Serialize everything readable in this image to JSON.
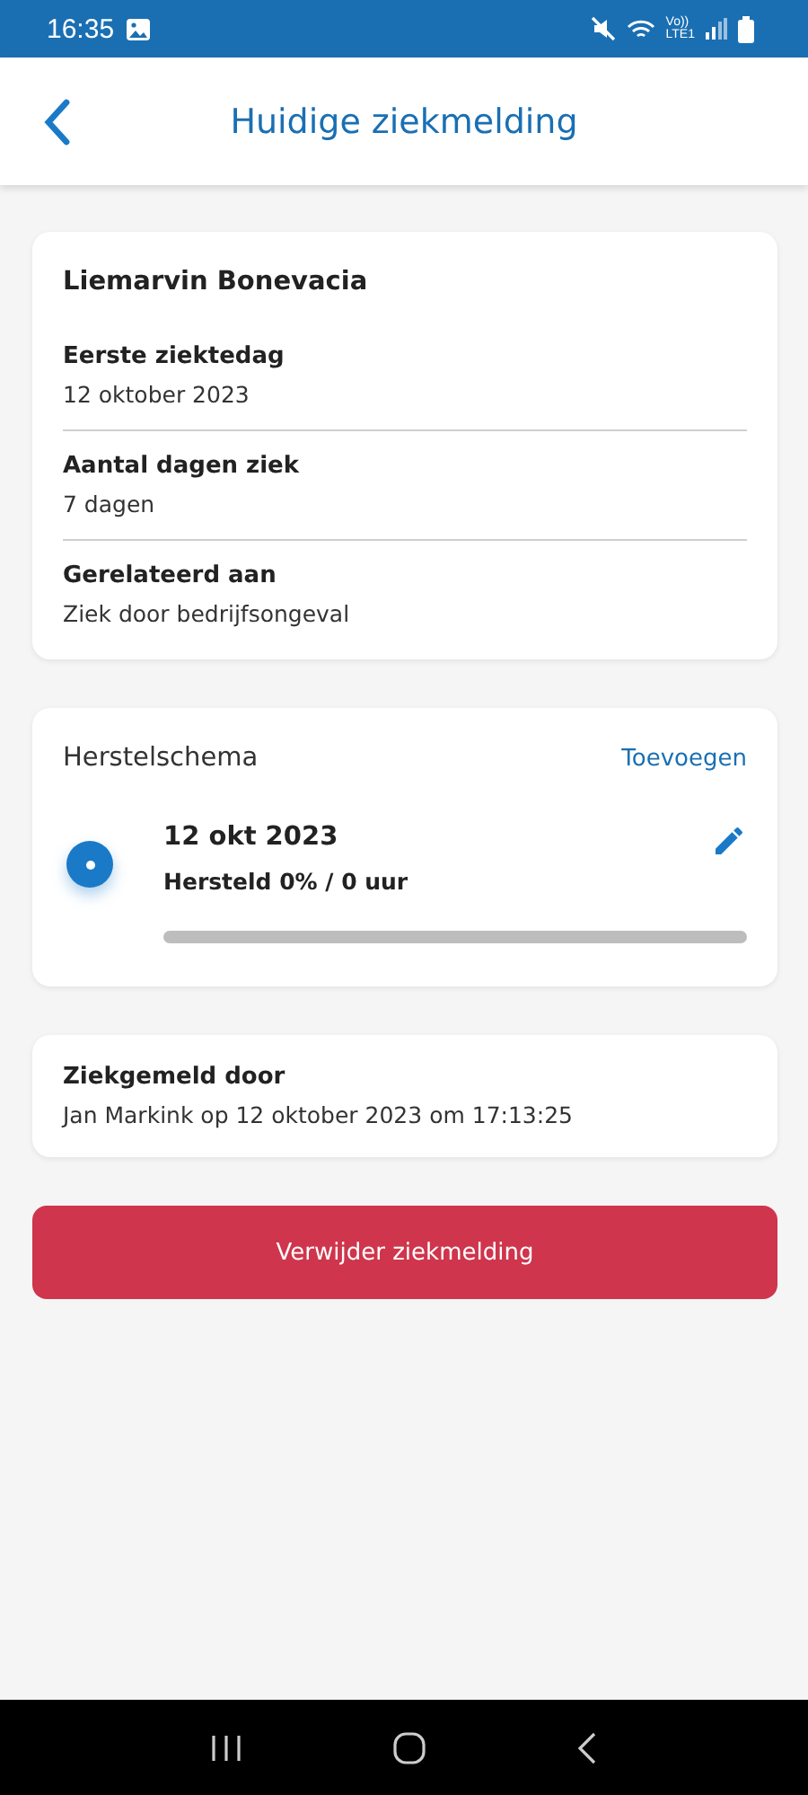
{
  "status_bar": {
    "time": "16:35",
    "network_top": "Vo))",
    "network_bottom": "LTE1"
  },
  "header": {
    "title": "Huidige ziekmelding"
  },
  "employee": {
    "name": "Liemarvin Bonevacia",
    "fields": [
      {
        "label": "Eerste ziektedag",
        "value": "12 oktober 2023"
      },
      {
        "label": "Aantal dagen ziek",
        "value": "7 dagen"
      },
      {
        "label": "Gerelateerd aan",
        "value": "Ziek door bedrijfsongeval"
      }
    ]
  },
  "recovery": {
    "title": "Herstelschema",
    "action": "Toevoegen",
    "entries": [
      {
        "date": "12 okt 2023",
        "summary": "Hersteld 0% / 0 uur",
        "level": 0
      }
    ]
  },
  "reported": {
    "label": "Ziekgemeld door",
    "value": "Jan Markink op 12 oktober 2023 om 17:13:25"
  },
  "delete_button": "Verwijder ziekmelding"
}
